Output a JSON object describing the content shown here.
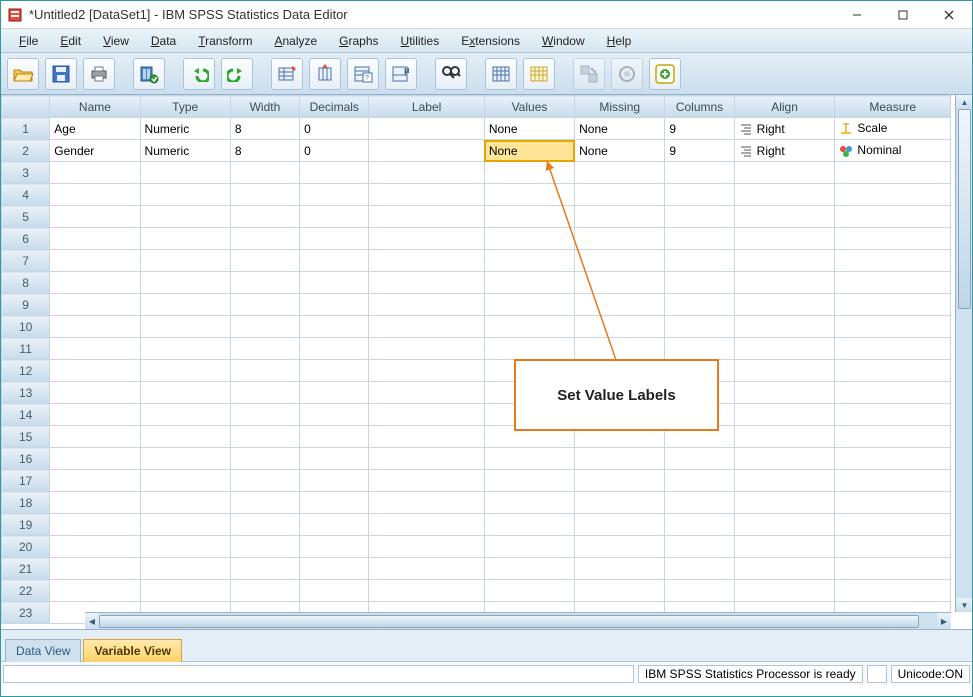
{
  "window": {
    "title": "*Untitled2 [DataSet1] - IBM SPSS Statistics Data Editor"
  },
  "menus": {
    "file": "File",
    "edit": "Edit",
    "view": "View",
    "data": "Data",
    "transform": "Transform",
    "analyze": "Analyze",
    "graphs": "Graphs",
    "utilities": "Utilities",
    "extensions": "Extensions",
    "window": "Window",
    "help": "Help"
  },
  "columns": {
    "name": "Name",
    "type": "Type",
    "width": "Width",
    "decimals": "Decimals",
    "label": "Label",
    "values": "Values",
    "missing": "Missing",
    "columns": "Columns",
    "align": "Align",
    "measure": "Measure"
  },
  "rows": [
    {
      "n": "1",
      "name": "Age",
      "type": "Numeric",
      "width": "8",
      "decimals": "0",
      "label": "",
      "values": "None",
      "missing": "None",
      "columns": "9",
      "align": "Right",
      "measure": "Scale"
    },
    {
      "n": "2",
      "name": "Gender",
      "type": "Numeric",
      "width": "8",
      "decimals": "0",
      "label": "",
      "values": "None",
      "missing": "None",
      "columns": "9",
      "align": "Right",
      "measure": "Nominal"
    }
  ],
  "empty_row_numbers": [
    "3",
    "4",
    "5",
    "6",
    "7",
    "8",
    "9",
    "10",
    "11",
    "12",
    "13",
    "14",
    "15",
    "16",
    "17",
    "18",
    "19",
    "20",
    "21",
    "22",
    "23"
  ],
  "annotation": {
    "text": "Set Value Labels"
  },
  "tabs": {
    "data_view": "Data View",
    "variable_view": "Variable View"
  },
  "status": {
    "processor": "IBM SPSS Statistics Processor is ready",
    "unicode": "Unicode:ON"
  }
}
